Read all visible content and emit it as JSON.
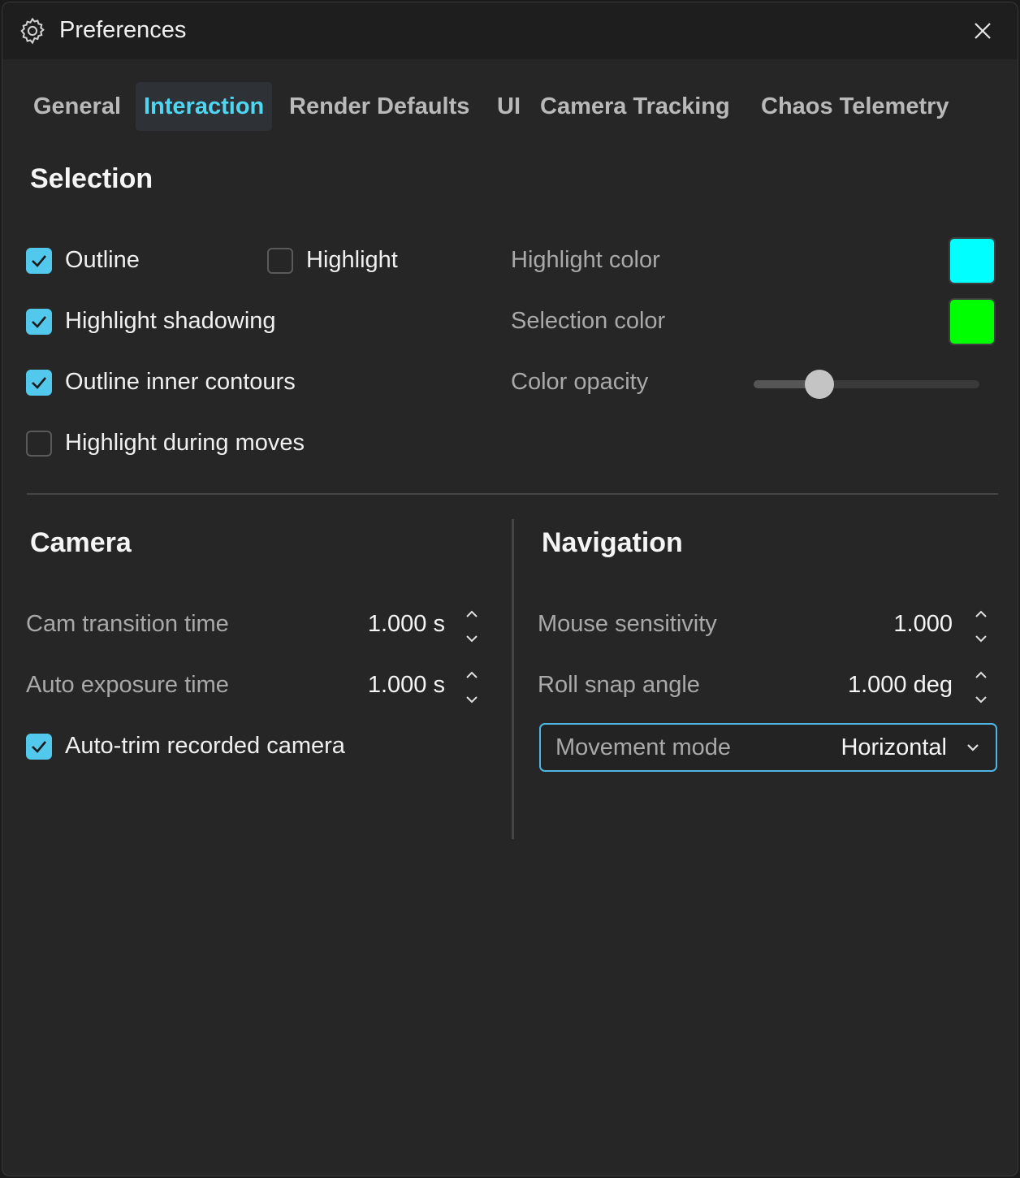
{
  "window": {
    "title": "Preferences"
  },
  "tabs": [
    {
      "label": "General"
    },
    {
      "label": "Interaction",
      "active": true
    },
    {
      "label": "Render Defaults"
    },
    {
      "label": "UI"
    },
    {
      "label": "Camera Tracking"
    },
    {
      "label": "Chaos Telemetry"
    }
  ],
  "selection": {
    "title": "Selection",
    "outline": {
      "label": "Outline",
      "checked": true
    },
    "highlight": {
      "label": "Highlight",
      "checked": false
    },
    "highlight_shadowing": {
      "label": "Highlight shadowing",
      "checked": true
    },
    "outline_inner_contours": {
      "label": "Outline inner contours",
      "checked": true
    },
    "highlight_during_moves": {
      "label": "Highlight during moves",
      "checked": false
    },
    "highlight_color": {
      "label": "Highlight color",
      "color": "#00ffff"
    },
    "selection_color": {
      "label": "Selection color",
      "color": "#00ff00"
    },
    "color_opacity": {
      "label": "Color opacity",
      "value": 0.29
    }
  },
  "camera": {
    "title": "Camera",
    "cam_transition_time": {
      "label": "Cam transition time",
      "value": "1.000 s"
    },
    "auto_exposure_time": {
      "label": "Auto exposure time",
      "value": "1.000 s"
    },
    "auto_trim": {
      "label": "Auto-trim recorded camera",
      "checked": true
    }
  },
  "navigation": {
    "title": "Navigation",
    "mouse_sensitivity": {
      "label": "Mouse sensitivity",
      "value": "1.000"
    },
    "roll_snap_angle": {
      "label": "Roll snap angle",
      "value": "1.000 deg"
    },
    "movement_mode": {
      "label": "Movement mode",
      "value": "Horizontal"
    }
  },
  "colors": {
    "accent": "#4fd6f2",
    "checkbox": "#52c8ed",
    "background": "#262626"
  }
}
